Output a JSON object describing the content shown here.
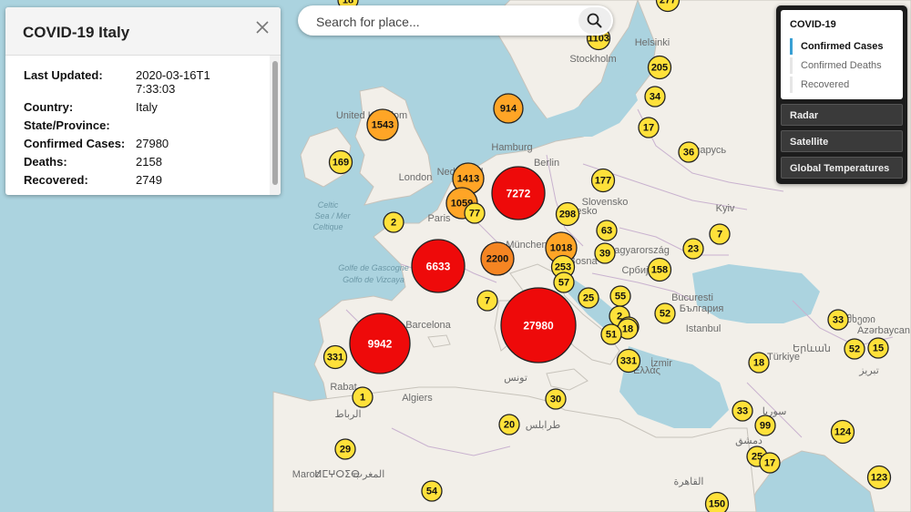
{
  "info_panel": {
    "title": "COVID-19 Italy",
    "rows": [
      {
        "label": "Last Updated:",
        "value": "2020-03-16T17:33:03"
      },
      {
        "label": "Country:",
        "value": "Italy"
      },
      {
        "label": "State/Province:",
        "value": ""
      },
      {
        "label": "Confirmed Cases:",
        "value": "27980"
      },
      {
        "label": "Deaths:",
        "value": "2158"
      },
      {
        "label": "Recovered:",
        "value": "2749"
      }
    ]
  },
  "search": {
    "placeholder": "Search for place..."
  },
  "layers": {
    "group_title": "COVID-19",
    "options": [
      {
        "label": "Confirmed Cases",
        "active": true
      },
      {
        "label": "Confirmed Deaths",
        "active": false
      },
      {
        "label": "Recovered",
        "active": false
      }
    ],
    "basemaps": [
      "Radar",
      "Satellite",
      "Global Temperatures"
    ]
  },
  "colors": {
    "water": "#abd3df",
    "land": "#f2efe9",
    "marker_small": "#ffe13a",
    "marker_medium": "#ffa526",
    "marker_mid_large": "#f58522",
    "marker_large": "#ee0a0a",
    "active_accent": "#39a0d4"
  },
  "map_labels": [
    "Stockholm",
    "Helsinki",
    "Hamburg",
    "Berlin",
    "London",
    "Paris",
    "Barcelona",
    "Algiers",
    "Bucuresti",
    "Istanbul",
    "Kyiv",
    "İzmir",
    "Rabat",
    "Maroc",
    "ⵍⵎⵖⵔⵉⴱ",
    "المغرب",
    "الرباط",
    "تونس",
    "طرابلس",
    "القاهرة",
    "دمشق",
    "Celtic",
    "Sea / Mer",
    "Celtique",
    "Golfe de Gascogne",
    "Golfo de Vizcaya",
    "United Kingdom",
    "Беларусь",
    "Slovensko",
    "Երևան",
    "تبريز",
    "Ελλάς",
    "България",
    "München",
    "Nederland",
    "Česko",
    "Magyarország",
    "Србија",
    "სომხეთი",
    "Azərbaycan",
    "سوریا",
    "Türkiye",
    "Bosna"
  ],
  "markers": [
    {
      "value": "277",
      "level": "small"
    },
    {
      "value": "18",
      "level": "small"
    },
    {
      "value": "1103",
      "level": "small"
    },
    {
      "value": "205",
      "level": "small"
    },
    {
      "value": "34",
      "level": "small"
    },
    {
      "value": "17",
      "level": "small"
    },
    {
      "value": "36",
      "level": "small"
    },
    {
      "value": "1543",
      "level": "medium"
    },
    {
      "value": "914",
      "level": "medium"
    },
    {
      "value": "169",
      "level": "small"
    },
    {
      "value": "1413",
      "level": "medium"
    },
    {
      "value": "7272",
      "level": "large"
    },
    {
      "value": "177",
      "level": "small"
    },
    {
      "value": "1059",
      "level": "medium"
    },
    {
      "value": "77",
      "level": "small"
    },
    {
      "value": "298",
      "level": "small"
    },
    {
      "value": "2",
      "level": "small"
    },
    {
      "value": "63",
      "level": "small"
    },
    {
      "value": "7",
      "level": "small"
    },
    {
      "value": "23",
      "level": "small"
    },
    {
      "value": "1018",
      "level": "medium"
    },
    {
      "value": "39",
      "level": "small"
    },
    {
      "value": "6633",
      "level": "large"
    },
    {
      "value": "2200",
      "level": "mid_large"
    },
    {
      "value": "253",
      "level": "small"
    },
    {
      "value": "158",
      "level": "small"
    },
    {
      "value": "57",
      "level": "small"
    },
    {
      "value": "7",
      "level": "small"
    },
    {
      "value": "25",
      "level": "small"
    },
    {
      "value": "55",
      "level": "small"
    },
    {
      "value": "27980",
      "level": "large"
    },
    {
      "value": "2",
      "level": "small"
    },
    {
      "value": "2",
      "level": "small"
    },
    {
      "value": "52",
      "level": "small"
    },
    {
      "value": "18",
      "level": "small"
    },
    {
      "value": "51",
      "level": "small"
    },
    {
      "value": "33",
      "level": "small"
    },
    {
      "value": "9942",
      "level": "large"
    },
    {
      "value": "331",
      "level": "small"
    },
    {
      "value": "331",
      "level": "small"
    },
    {
      "value": "52",
      "level": "small"
    },
    {
      "value": "15",
      "level": "small"
    },
    {
      "value": "18",
      "level": "small"
    },
    {
      "value": "1",
      "level": "small"
    },
    {
      "value": "30",
      "level": "small"
    },
    {
      "value": "33",
      "level": "small"
    },
    {
      "value": "99",
      "level": "small"
    },
    {
      "value": "20",
      "level": "small"
    },
    {
      "value": "124",
      "level": "small"
    },
    {
      "value": "29",
      "level": "small"
    },
    {
      "value": "25",
      "level": "small"
    },
    {
      "value": "17",
      "level": "small"
    },
    {
      "value": "123",
      "level": "small"
    },
    {
      "value": "54",
      "level": "small"
    },
    {
      "value": "150",
      "level": "small"
    }
  ]
}
